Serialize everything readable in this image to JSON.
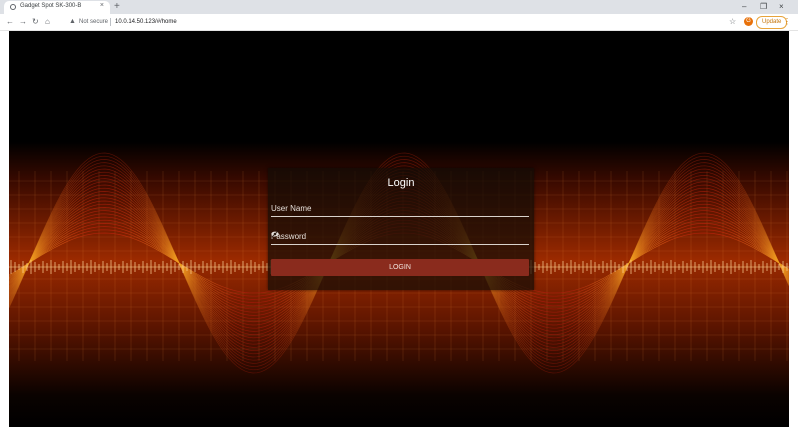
{
  "browser": {
    "tab_title": "Gadget Spot SK-300-B",
    "tab_close": "×",
    "new_tab": "+",
    "controls": {
      "minimize": "–",
      "restore": "❐",
      "close": "×"
    },
    "nav": {
      "back": "←",
      "forward": "→",
      "reload": "↻",
      "home": "⌂"
    },
    "security_text": "Not secure",
    "url": "10.0.14.50.123/#/home",
    "bookmark": "☆",
    "profile_initial": "G",
    "update_label": "Update",
    "menu": "⋮"
  },
  "login": {
    "title": "Login",
    "username_label": "User Name",
    "password_label": "Password",
    "button_label": "LOGIN"
  },
  "colors": {
    "accent_button": "#8a2b1d",
    "page_background": "#000000",
    "wave_bright": "#f0a020",
    "wave_dark": "#a8180a"
  }
}
